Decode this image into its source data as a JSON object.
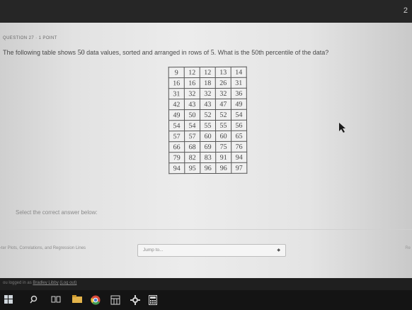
{
  "top_bar": {
    "corner_number": "2"
  },
  "question": {
    "header": "QUESTION 27 · 1 POINT",
    "text_before_count": "The following table shows ",
    "count": "50",
    "text_mid": " data values, sorted and arranged in rows of ",
    "row_size": "5",
    "text_after": ". What is the 50th percentile of the data?"
  },
  "table_rows": [
    [
      "9",
      "12",
      "12",
      "13",
      "14"
    ],
    [
      "16",
      "16",
      "18",
      "26",
      "31"
    ],
    [
      "31",
      "32",
      "32",
      "32",
      "36"
    ],
    [
      "42",
      "43",
      "43",
      "47",
      "49"
    ],
    [
      "49",
      "50",
      "52",
      "52",
      "54"
    ],
    [
      "54",
      "54",
      "55",
      "55",
      "56"
    ],
    [
      "57",
      "57",
      "60",
      "60",
      "65"
    ],
    [
      "66",
      "68",
      "69",
      "75",
      "76"
    ],
    [
      "79",
      "82",
      "83",
      "91",
      "94"
    ],
    [
      "94",
      "95",
      "96",
      "96",
      "97"
    ]
  ],
  "answer": {
    "select_label": "Select the correct answer below:"
  },
  "footer": {
    "prev_link": "‹ter Plots, Correlations, and Regression Lines",
    "jump_value": "Jump to...",
    "next_fragment": "Re"
  },
  "login": {
    "prefix": "ou logged in as ",
    "user": "Bradley Libby",
    "logout": "(Log out)"
  },
  "colors": {
    "page_bg": "#e6e6e6",
    "text": "#4a4a4a",
    "table_border": "#555555"
  },
  "taskbar": {
    "icons": [
      "windows-icon",
      "search-icon",
      "task-view-icon",
      "file-explorer-icon",
      "store-icon",
      "chrome-icon",
      "calendar-icon",
      "photos-icon",
      "settings-icon",
      "word-icon",
      "calculator-icon"
    ]
  }
}
